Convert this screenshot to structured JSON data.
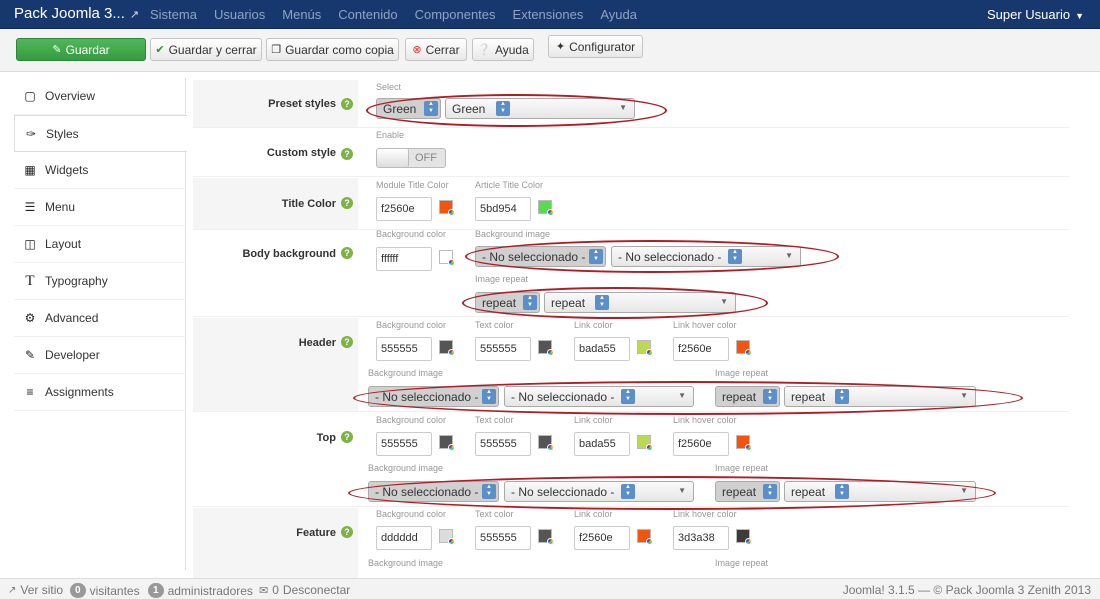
{
  "app": {
    "title": "Pack Joomla 3...",
    "user": "Super Usuario"
  },
  "nav": [
    "Sistema",
    "Usuarios",
    "Menús",
    "Contenido",
    "Componentes",
    "Extensiones",
    "Ayuda"
  ],
  "toolbar": {
    "save": "Guardar",
    "save_close": "Guardar y cerrar",
    "save_copy": "Guardar como copia",
    "close": "Cerrar",
    "help": "Ayuda",
    "configurator": "Configurator"
  },
  "sidebar": {
    "items": [
      {
        "label": "Overview",
        "icon": "square-icon"
      },
      {
        "label": "Styles",
        "icon": "brush-icon"
      },
      {
        "label": "Widgets",
        "icon": "grid-icon"
      },
      {
        "label": "Menu",
        "icon": "menu-icon"
      },
      {
        "label": "Layout",
        "icon": "layout-icon"
      },
      {
        "label": "Typography",
        "icon": "text-icon"
      },
      {
        "label": "Advanced",
        "icon": "gear-icon"
      },
      {
        "label": "Developer",
        "icon": "edit-icon"
      },
      {
        "label": "Assignments",
        "icon": "list-icon"
      }
    ]
  },
  "preset": {
    "label": "Preset styles",
    "caption": "Select",
    "value1": "Green",
    "value2": "Green"
  },
  "custom": {
    "label": "Custom style",
    "caption": "Enable",
    "toggle": "OFF"
  },
  "title_color": {
    "label": "Title Color",
    "module_caption": "Module Title Color",
    "module_value": "f2560e",
    "module_color": "#f2560e",
    "article_caption": "Article Title Color",
    "article_value": "5bd954",
    "article_color": "#5bd954"
  },
  "body_bg": {
    "label": "Body background",
    "bg_color_caption": "Background color",
    "bg_color": "ffffff",
    "bg_swatch": "#ffffff",
    "bg_image_caption": "Background image",
    "bg_image1": "- No seleccionado -",
    "bg_image2": "- No seleccionado -",
    "repeat_caption": "Image repeat",
    "repeat1": "repeat",
    "repeat2": "repeat"
  },
  "header": {
    "label": "Header",
    "bg_caption": "Background color",
    "bg_value": "555555",
    "bg_swatch": "#555555",
    "text_caption": "Text color",
    "text_value": "555555",
    "text_swatch": "#555555",
    "link_caption": "Link color",
    "link_value": "bada55",
    "link_swatch": "#bada55",
    "hover_caption": "Link hover color",
    "hover_value": "f2560e",
    "hover_swatch": "#f2560e",
    "image_caption": "Background image",
    "image1": "- No seleccionado -",
    "image2": "- No seleccionado -",
    "repeat_caption": "Image repeat",
    "repeat1": "repeat",
    "repeat2": "repeat"
  },
  "top": {
    "label": "Top",
    "bg_caption": "Background color",
    "bg_value": "555555",
    "bg_swatch": "#555555",
    "text_caption": "Text color",
    "text_value": "555555",
    "text_swatch": "#555555",
    "link_caption": "Link color",
    "link_value": "bada55",
    "link_swatch": "#bada55",
    "hover_caption": "Link hover color",
    "hover_value": "f2560e",
    "hover_swatch": "#f2560e",
    "image_caption": "Background image",
    "image1": "- No seleccionado -",
    "image2": "- No seleccionado -",
    "repeat_caption": "Image repeat",
    "repeat1": "repeat",
    "repeat2": "repeat"
  },
  "feature": {
    "label": "Feature",
    "bg_caption": "Background color",
    "bg_value": "dddddd",
    "bg_swatch": "#dddddd",
    "text_caption": "Text color",
    "text_value": "555555",
    "text_swatch": "#555555",
    "link_caption": "Link color",
    "link_value": "f2560e",
    "link_swatch": "#f2560e",
    "hover_caption": "Link hover color",
    "hover_value": "3d3a38",
    "hover_swatch": "#3d3a38",
    "image_caption": "Background image",
    "repeat_caption": "Image repeat"
  },
  "footer": {
    "view_site": "Ver sitio",
    "visitors_count": "0",
    "visitors": "visitantes",
    "admins_count": "1",
    "admins": "administradores",
    "logout_count": "0",
    "logout": "Desconectar",
    "copyright": "Joomla! 3.1.5 — © Pack Joomla 3 Zenith 2013"
  },
  "colors": {
    "highlight_ring": "#b11c25",
    "nav_bg": "#17386e",
    "save_green": "#46a54f"
  }
}
